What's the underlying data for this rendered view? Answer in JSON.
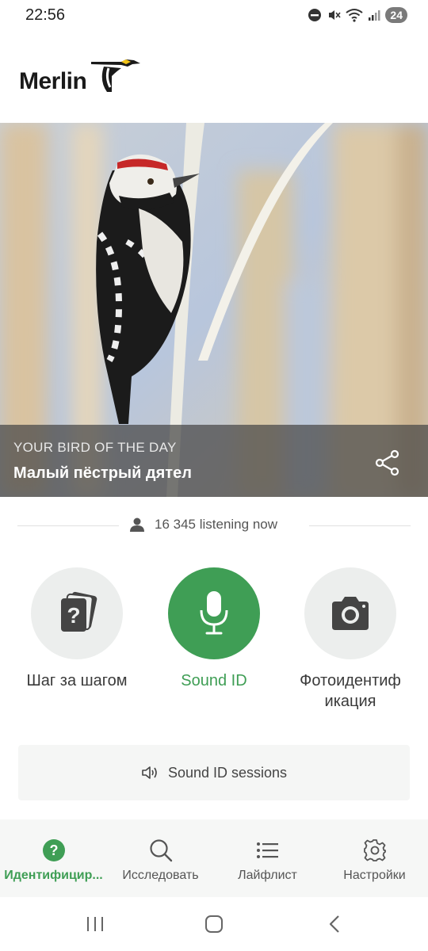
{
  "status_bar": {
    "time": "22:56",
    "battery_level": "24"
  },
  "header": {
    "logo_text": "Merlin"
  },
  "hero": {
    "caption": "YOUR BIRD OF THE DAY",
    "bird_name": "Малый пёстрый дятел"
  },
  "listening": {
    "text": "16 345 listening now"
  },
  "modes": [
    {
      "label": "Шаг за шагом",
      "icon": "question-cards-icon"
    },
    {
      "label": "Sound ID",
      "icon": "microphone-icon"
    },
    {
      "label": "Фотоидентиф икация",
      "icon": "camera-icon"
    }
  ],
  "sessions_button": {
    "label": "Sound ID sessions",
    "icon": "speaker-icon"
  },
  "tabs": [
    {
      "label": "Идентифицир...",
      "icon": "question-circle-icon",
      "active": true
    },
    {
      "label": "Исследовать",
      "icon": "search-icon"
    },
    {
      "label": "Лайфлист",
      "icon": "list-icon"
    },
    {
      "label": "Настройки",
      "icon": "gear-icon"
    }
  ],
  "colors": {
    "accent": "#3f9e55",
    "mode_circle": "#eceeed"
  }
}
